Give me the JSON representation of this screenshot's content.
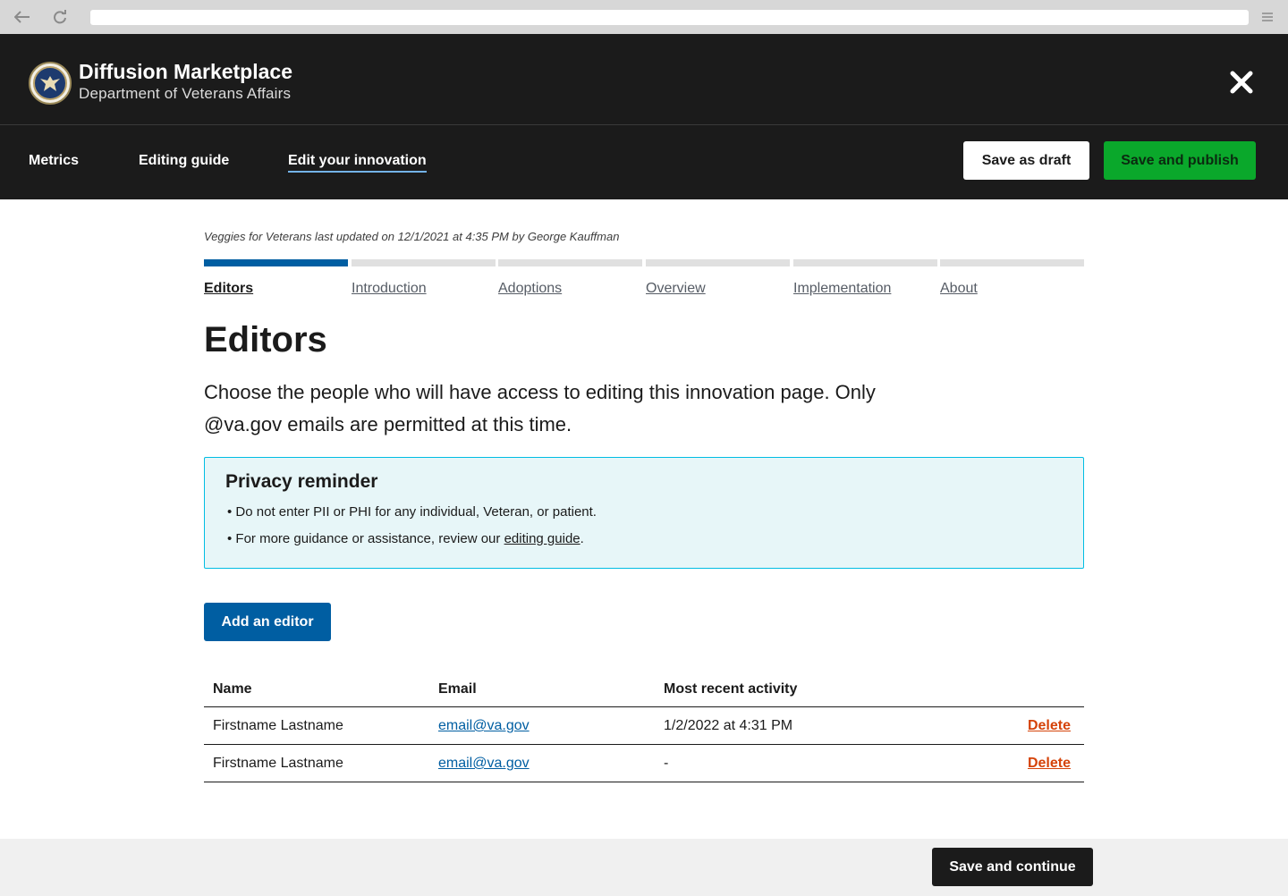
{
  "browser": {
    "back_icon": "arrow-left-icon",
    "reload_icon": "reload-icon",
    "menu_icon": "hamburger-menu-icon",
    "url": ""
  },
  "header": {
    "title": "Diffusion Marketplace",
    "subtitle": "Department of Veterans Affairs",
    "logo_icon": "va-seal-icon",
    "close_icon": "close-icon"
  },
  "nav": {
    "links": [
      "Metrics",
      "Editing guide",
      "Edit your innovation"
    ],
    "active_index": 2,
    "save_draft_label": "Save as draft",
    "save_publish_label": "Save and publish"
  },
  "main": {
    "updated_text": "Veggies for Veterans last updated on 12/1/2021 at 4:35 PM by George Kauffman",
    "steps": [
      "Editors",
      "Introduction",
      "Adoptions",
      "Overview",
      "Implementation",
      "About"
    ],
    "active_step": 0,
    "title": "Editors",
    "intro": "Choose the people who will have access to editing this innovation page. Only @va.gov emails are permitted at this time.",
    "alert": {
      "title": "Privacy reminder",
      "item1": "Do not enter PII or PHI for any individual, Veteran, or patient.",
      "item2_prefix": "For more guidance or assistance, review our ",
      "item2_link": "editing guide",
      "item2_suffix": "."
    },
    "add_editor_label": "Add an editor",
    "table": {
      "headers": [
        "Name",
        "Email",
        "Most recent activity"
      ],
      "rows": [
        {
          "name": "Firstname Lastname",
          "email": "email@va.gov",
          "activity": "1/2/2022 at 4:31 PM",
          "action": "Delete"
        },
        {
          "name": "Firstname Lastname",
          "email": "email@va.gov",
          "activity": "-",
          "action": "Delete"
        }
      ]
    }
  },
  "footer": {
    "save_continue_label": "Save and continue"
  },
  "colors": {
    "header_bg": "#1b1b1b",
    "primary": "#005ea2",
    "publish": "#0aa82b",
    "alert_bg": "#e7f6f8",
    "alert_border": "#00bde3",
    "delete": "#d54309"
  }
}
